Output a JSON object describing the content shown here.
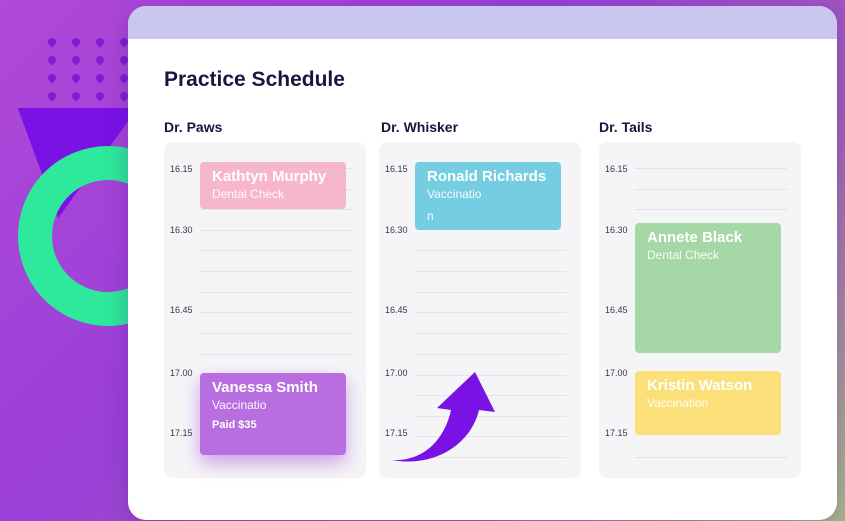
{
  "title": "Practice Schedule",
  "doctors": [
    {
      "name": "Dr. Paws",
      "times": [
        "16.15",
        "16.30",
        "16.45",
        "17.00",
        "17.15"
      ],
      "appointments": [
        {
          "name": "Kathtyn Murphy",
          "type": "Dental Check",
          "color": "#f6b6cc"
        },
        {
          "name": "Vanessa Smith",
          "type": "Vaccinatio",
          "extra": "Paid $35",
          "color": "#b96ee0"
        }
      ]
    },
    {
      "name": "Dr. Whisker",
      "times": [
        "16.15",
        "16.30",
        "16.45",
        "17.00",
        "17.15"
      ],
      "appointments": [
        {
          "name": "Ronald Richards",
          "type": "Vaccinatio",
          "extra": "n",
          "color": "#74cde0"
        }
      ]
    },
    {
      "name": "Dr. Tails",
      "times": [
        "16.15",
        "16.30",
        "16.45",
        "17.00",
        "17.15"
      ],
      "appointments": [
        {
          "name": "Annete Black",
          "type": "Dental Check",
          "color": "#a6d7a6"
        },
        {
          "name": "Kristin Watson",
          "type": "Vaccination",
          "color": "#fbe07a"
        }
      ]
    }
  ],
  "colors": {
    "accent": "#7a12e6",
    "ring": "#2ee89b",
    "header": "#c9c7f0"
  }
}
